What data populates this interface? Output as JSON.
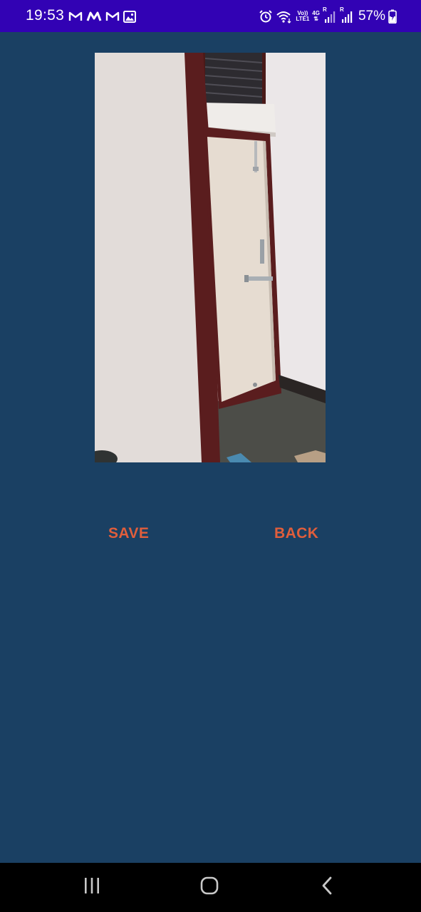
{
  "status_bar": {
    "time": "19:53",
    "notification_icons": [
      "gmail-icon",
      "messaging-icon",
      "gmail-icon",
      "gallery-icon"
    ],
    "network_label_top": "Vo))",
    "network_label_bottom": "LTE1",
    "network_type": "4G",
    "roaming_1": "R",
    "roaming_2": "R",
    "battery_percent": "57%"
  },
  "photo": {
    "subject": "captured-photo"
  },
  "actions": {
    "save_label": "SAVE",
    "back_label": "BACK"
  },
  "colors": {
    "background": "#1a4063",
    "status_bar": "#3202b4",
    "button_text": "#e05e3c",
    "nav_bar": "#000000"
  },
  "nav_bar": {
    "buttons": [
      "recents-icon",
      "home-icon",
      "back-icon"
    ]
  }
}
